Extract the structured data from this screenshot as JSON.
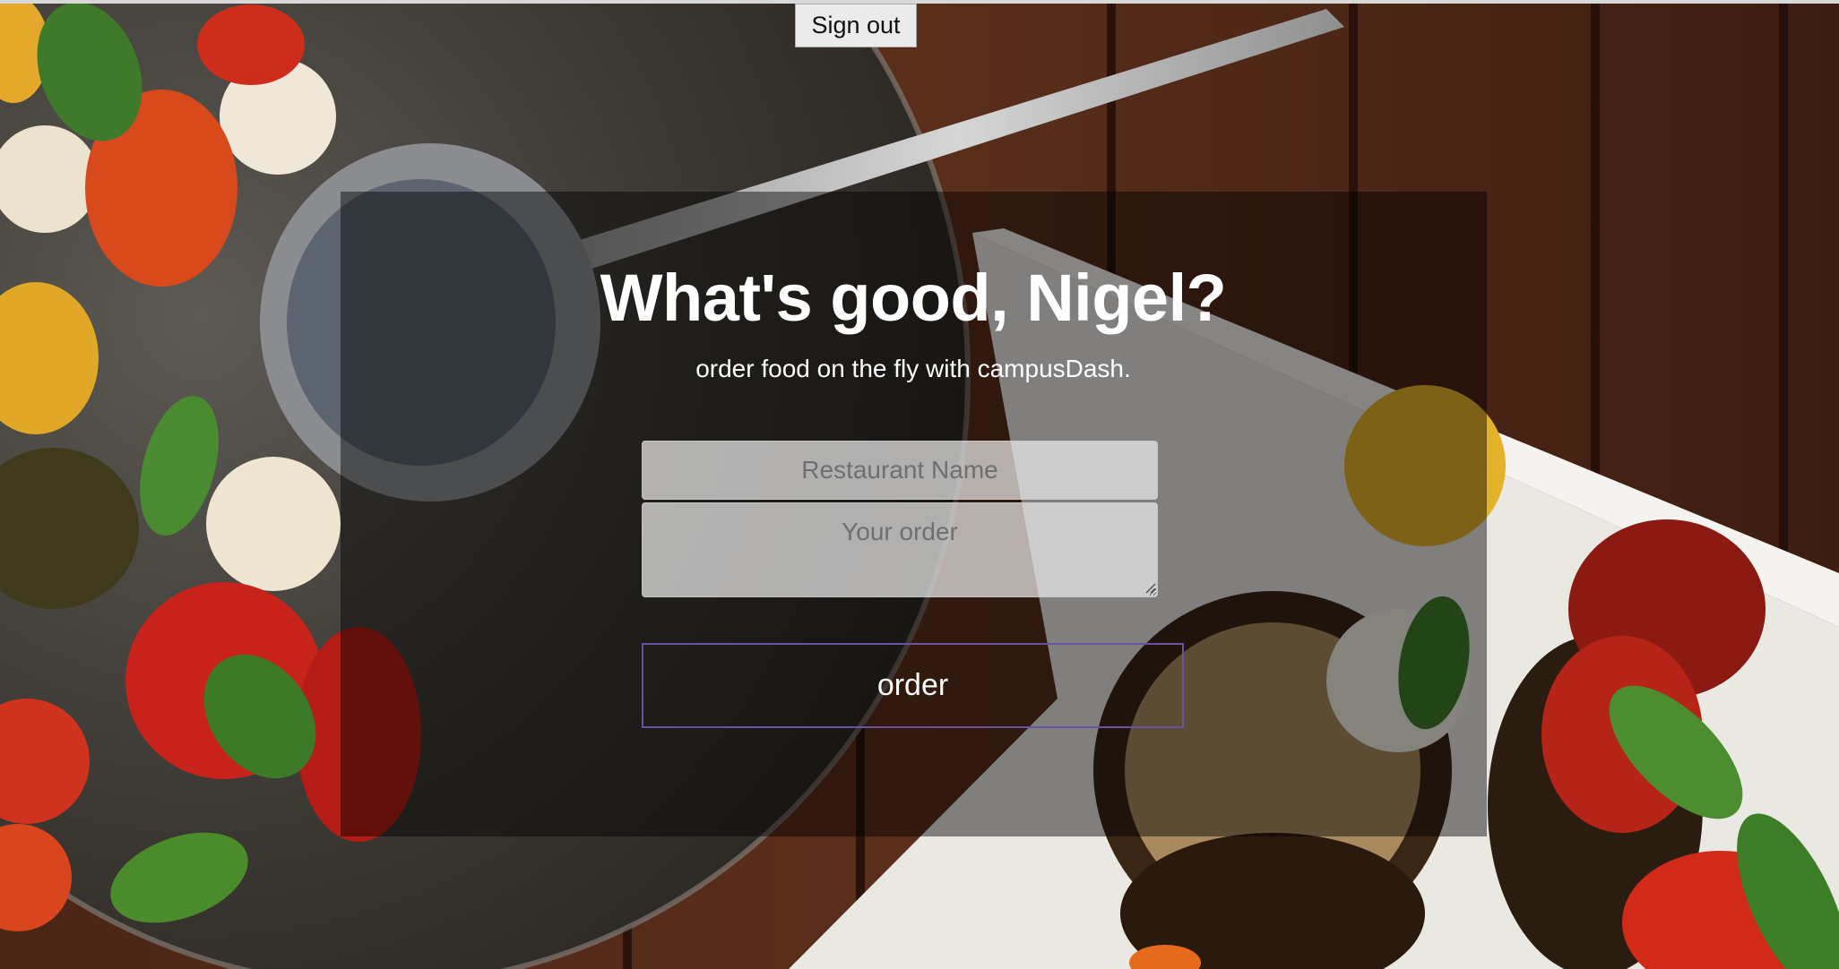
{
  "header": {
    "signout_label": "Sign out"
  },
  "hero": {
    "headline": "What's good, Nigel?",
    "tagline": "order food on the fly with campusDash."
  },
  "form": {
    "restaurant_placeholder": "Restaurant Name",
    "restaurant_value": "",
    "order_placeholder": "Your order",
    "order_value": "",
    "submit_label": "order"
  },
  "colors": {
    "button_border": "#6a52a3",
    "panel_overlay": "rgba(0,0,0,0.45)",
    "text": "#ffffff"
  }
}
